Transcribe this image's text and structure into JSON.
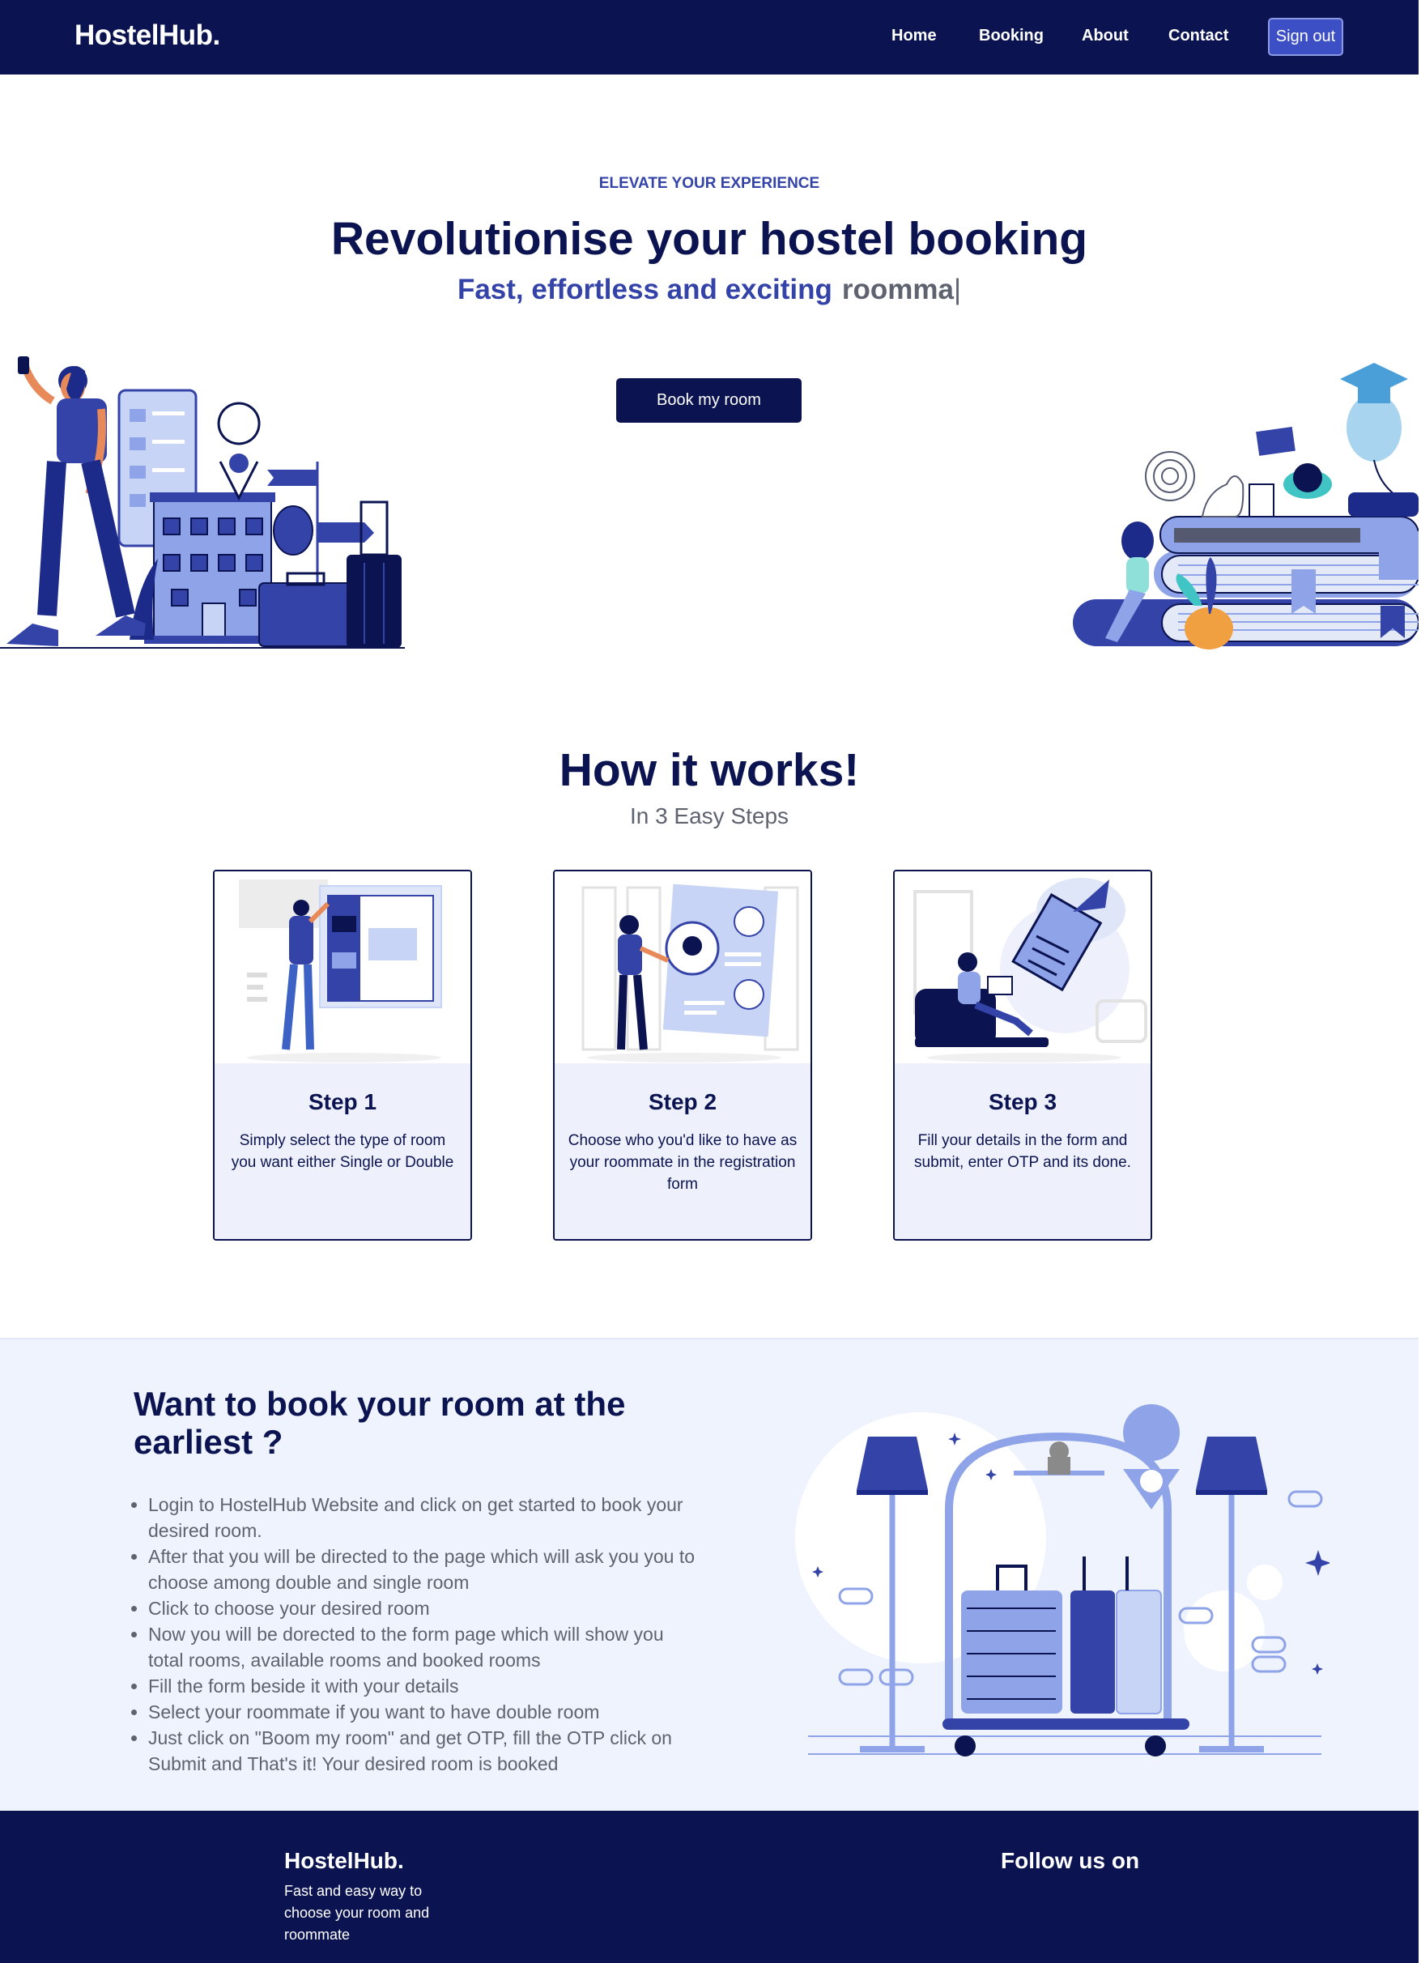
{
  "nav": {
    "brand": "HostelHub.",
    "links": [
      "Home",
      "Booking",
      "About",
      "Contact"
    ],
    "signout_label": "Sign out"
  },
  "hero": {
    "eyebrow": "ELEVATE YOUR EXPERIENCE",
    "title": "Revolutionise your hostel booking",
    "subtitle_static": "Fast, effortless and exciting",
    "subtitle_typed": "roomma",
    "cursor": "|",
    "cta_label": "Book my room"
  },
  "how": {
    "title": "How it works!",
    "subtitle": "In 3 Easy Steps",
    "steps": [
      {
        "title": "Step 1",
        "desc": "Simply select the type of room you want either Single or Double"
      },
      {
        "title": "Step 2",
        "desc": "Choose who you'd like to have as your roommate in the registration form"
      },
      {
        "title": "Step 3",
        "desc": "Fill your details in the form and submit, enter OTP and its done."
      }
    ]
  },
  "book": {
    "title": "Want to book your room at the earliest ?",
    "items": [
      "Login to HostelHub Website and click on get started to book your desired room.",
      "After that you will be directed to the page which will ask you you to choose among double and single room",
      "Click to choose your desired room",
      "Now you will be dorected to the form page which will show you total rooms, available rooms and booked rooms",
      "Fill the form beside it with your details",
      "Select your roommate if you want to have double room",
      "Just click on \"Boom my room\" and get OTP, fill the OTP click on Submit and That's it! Your desired room is booked"
    ]
  },
  "footer": {
    "brand": "HostelHub.",
    "tagline": "Fast and easy way to choose your room and roommate",
    "follow": "Follow us on"
  },
  "colors": {
    "navy": "#0b1450",
    "accent": "#3443a8",
    "light_bg": "#eef3fd"
  }
}
